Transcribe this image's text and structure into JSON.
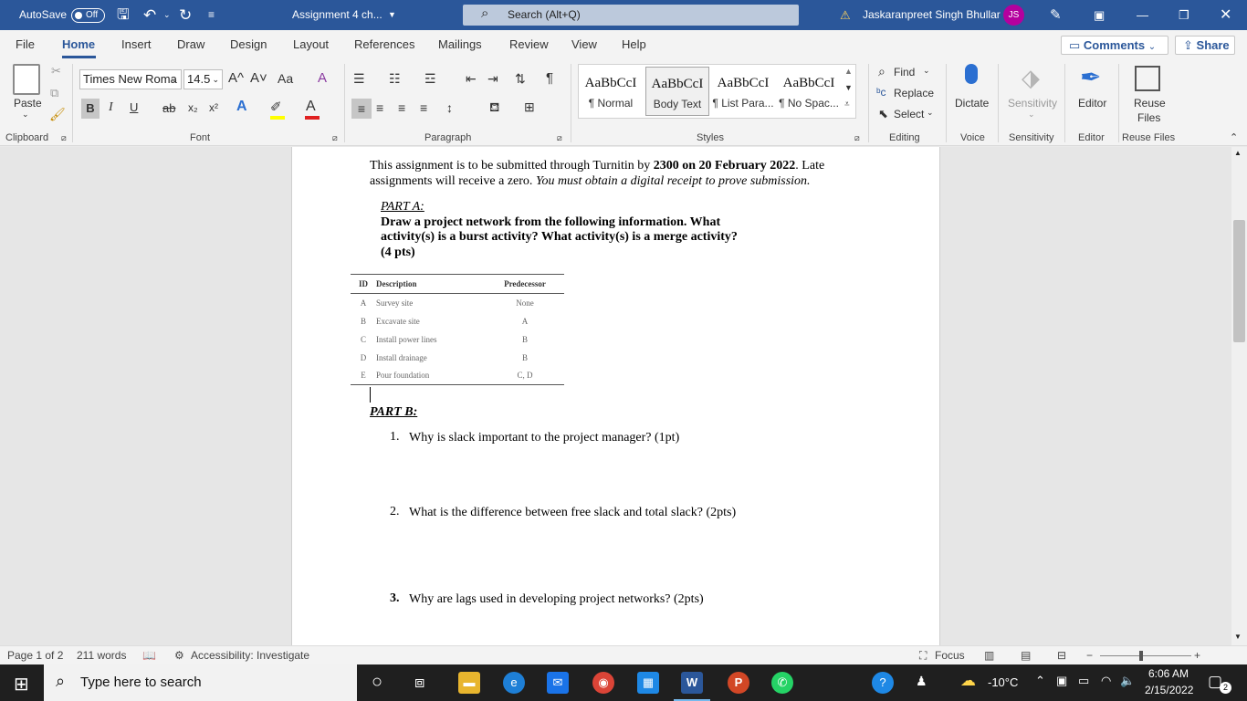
{
  "titlebar": {
    "autosave_label": "AutoSave",
    "autosave_state": "Off",
    "doc_title": "Assignment 4 ch...",
    "search_placeholder": "Search (Alt+Q)",
    "user_name": "Jaskaranpreet Singh Bhullar",
    "user_initials": "JS"
  },
  "tabs": [
    "File",
    "Home",
    "Insert",
    "Draw",
    "Design",
    "Layout",
    "References",
    "Mailings",
    "Review",
    "View",
    "Help"
  ],
  "top_buttons": {
    "comments": "Comments",
    "share": "Share"
  },
  "ribbon": {
    "clipboard": {
      "paste": "Paste",
      "label": "Clipboard"
    },
    "font": {
      "family": "Times New Roma",
      "size": "14.5",
      "label": "Font",
      "bold": "B",
      "italic": "I",
      "underline": "U",
      "strike": "ab",
      "sub": "x₂",
      "sup": "x²",
      "grow": "A^",
      "shrink": "A˅",
      "case": "Aa",
      "clear": "A"
    },
    "paragraph": {
      "label": "Paragraph",
      "pilcrow": "¶"
    },
    "styles": {
      "label": "Styles",
      "items": [
        {
          "sample": "AaBbCcI",
          "name": "¶ Normal"
        },
        {
          "sample": "AaBbCcI",
          "name": "Body Text"
        },
        {
          "sample": "AaBbCcI",
          "name": "¶ List Para..."
        },
        {
          "sample": "AaBbCcI",
          "name": "¶ No Spac..."
        }
      ]
    },
    "editing": {
      "find": "Find",
      "replace": "Replace",
      "select": "Select",
      "label": "Editing"
    },
    "voice": {
      "dictate": "Dictate",
      "label": "Voice"
    },
    "sensitivity": {
      "button": "Sensitivity",
      "label": "Sensitivity"
    },
    "editor": {
      "button": "Editor",
      "label": "Editor"
    },
    "reuse": {
      "button_line1": "Reuse",
      "button_line2": "Files",
      "label": "Reuse Files"
    }
  },
  "document": {
    "intro_1_pre": "This assignment is to be submitted through Turnitin by ",
    "intro_1_bold": "2300 on 20 February 2022",
    "intro_1_post": ".  Late",
    "intro_2_pre": "assignments will receive a zero.  ",
    "intro_2_italic": "You must obtain a digital receipt to prove submission.",
    "part_a_heading": "PART A:",
    "part_a_line1": "Draw a project network from the following information. What",
    "part_a_line2": "activity(s) is a burst activity? What activity(s) is a merge activity?",
    "part_a_line3": "(4 pts)",
    "table": {
      "headers": [
        "ID",
        "Description",
        "Predecessor"
      ],
      "rows": [
        [
          "A",
          "Survey site",
          "None"
        ],
        [
          "B",
          "Excavate site",
          "A"
        ],
        [
          "C",
          "Install power lines",
          "B"
        ],
        [
          "D",
          "Install drainage",
          "B"
        ],
        [
          "E",
          "Pour foundation",
          "C, D"
        ]
      ]
    },
    "part_b_heading": "PART B:",
    "questions": [
      {
        "num": "1.",
        "text": "Why is slack important to the project manager? (1pt)"
      },
      {
        "num": "2.",
        "text": "What is the difference between free slack and total slack? (2pts)"
      },
      {
        "num": "3.",
        "text": "Why are lags used in developing project networks? (2pts)"
      }
    ]
  },
  "statusbar": {
    "page": "Page 1 of 2",
    "words": "211 words",
    "accessibility": "Accessibility: Investigate",
    "focus": "Focus"
  },
  "taskbar": {
    "search_placeholder": "Type here to search",
    "temperature": "-10°C",
    "time": "6:06 AM",
    "date": "2/15/2022",
    "notification_count": "2"
  }
}
